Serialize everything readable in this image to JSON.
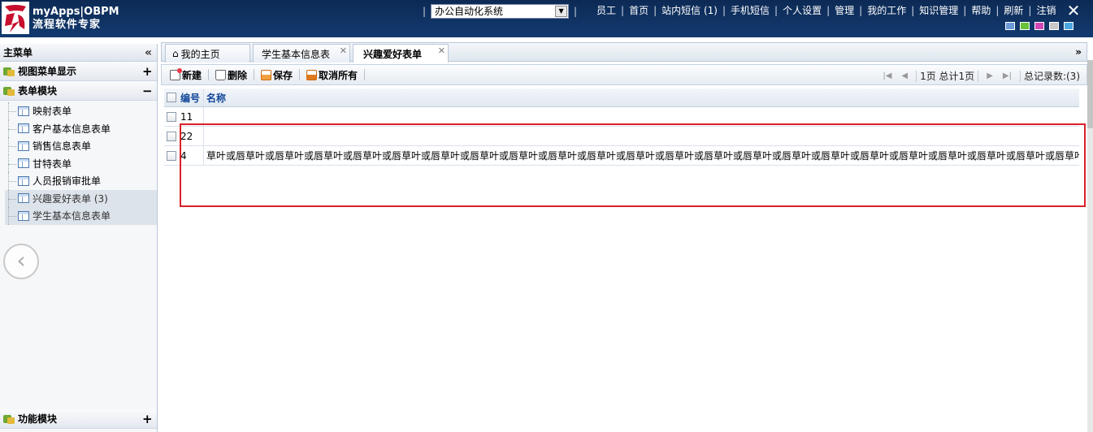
{
  "header": {
    "brand_line1": "myApps|OBPM",
    "brand_line2": "流程软件专家",
    "system_select": "办公自动化系统",
    "nav": [
      "员工",
      "首页",
      "站内短信 (1)",
      "手机短信",
      "个人设置",
      "管理",
      "我的工作",
      "知识管理",
      "帮助",
      "刷新",
      "注销"
    ],
    "skins": [
      "#6a9ad8",
      "#68c23a",
      "#d246b8",
      "#c8c8c8",
      "#4aa6e0"
    ]
  },
  "sidebar": {
    "title": "主菜单",
    "collapse": "«",
    "groups": [
      {
        "label": "视图菜单显示",
        "toggle": "+"
      },
      {
        "label": "表单模块",
        "toggle": "−"
      }
    ],
    "items": [
      {
        "label": "映射表单"
      },
      {
        "label": "客户基本信息表单"
      },
      {
        "label": "销售信息表单"
      },
      {
        "label": "甘特表单"
      },
      {
        "label": "人员报销审批单"
      },
      {
        "label": "兴趣爱好表单 (3)"
      },
      {
        "label": "学生基本信息表单"
      }
    ],
    "bottom_group": {
      "label": "功能模块",
      "toggle": "+"
    }
  },
  "tabs": [
    {
      "label": "我的主页",
      "close": ""
    },
    {
      "label": "学生基本信息表",
      "close": "✕"
    },
    {
      "label": "兴趣爱好表单",
      "close": "✕"
    }
  ],
  "tab_more": "»",
  "toolbar": {
    "new": "新建",
    "delete": "删除",
    "save": "保存",
    "cancel_all": "取消所有",
    "page_info": "1页 总计1页",
    "total": "总记录数:(3)"
  },
  "grid": {
    "headers": [
      "编号",
      "名称"
    ],
    "rows": [
      {
        "id": "11",
        "name": ""
      },
      {
        "id": "22",
        "name": ""
      },
      {
        "id": "4",
        "name": "草叶或唇草叶或唇草叶或唇草叶或唇草叶或唇草叶或唇草叶或唇草叶或唇草叶或唇草叶或唇草叶或唇草叶或唇草叶或唇草叶或唇草叶或唇草叶或唇草叶或唇草叶或唇草叶或唇草叶或唇草叶或唇草叶或唇草叶或唇草叶或"
      }
    ]
  }
}
